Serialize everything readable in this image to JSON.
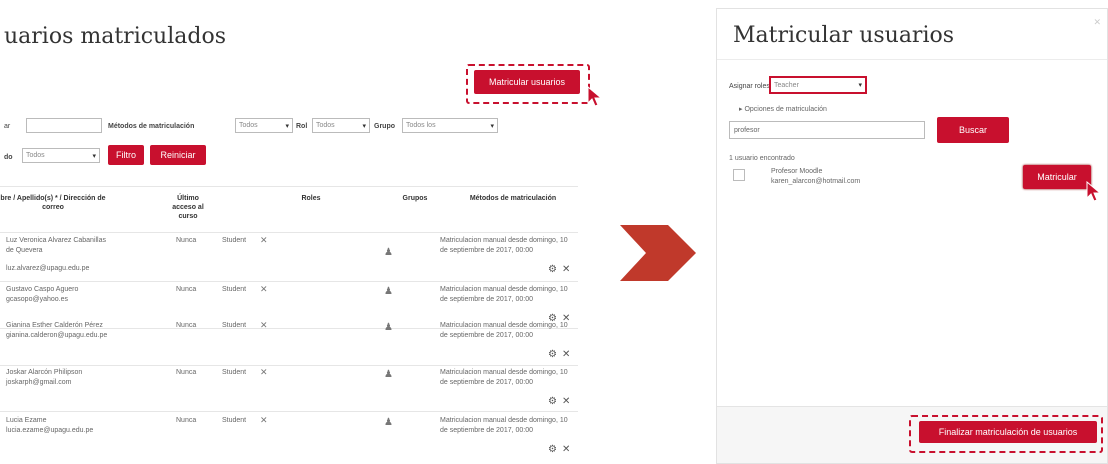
{
  "left_panel": {
    "title": "uarios matriculados",
    "enrol_button": "Matricular usuarios",
    "filters": {
      "search_label": "ar",
      "search_value": "",
      "methods_label": "Métodos de matriculación",
      "methods_value": "Todos",
      "role_label": "Rol",
      "role_value": "Todos",
      "group_label": "Grupo",
      "group_value": "Todos los",
      "status_label": "do",
      "status_value": "Todos",
      "filter_button": "Filtro",
      "reset_button": "Reiniciar"
    },
    "columns": [
      "bre / Apellido(s) * / Dirección de correo",
      "Último acceso al curso",
      "Roles",
      "Grupos",
      "Métodos de matriculación"
    ],
    "rows": [
      {
        "name": "Luz Veronica Alvarez Cabanillas de Quevera",
        "email": "luz.alvarez@upagu.edu.pe",
        "last_access": "Nunca",
        "role": "Student",
        "method": "Matriculacion manual desde domingo, 10 de septiembre de 2017, 00:00"
      },
      {
        "name": "Gustavo Caspo Aguero",
        "email": "gcasopo@yahoo.es",
        "last_access": "Nunca",
        "role": "Student",
        "method": "Matriculacion manual desde domingo, 10 de septiembre de 2017, 00:00"
      },
      {
        "name": "Gianina Esther Calderón Pérez",
        "email": "gianina.calderon@upagu.edu.pe",
        "last_access": "Nunca",
        "role": "Student",
        "method": "Matriculacion manual desde domingo, 10 de septiembre de 2017, 00:00"
      },
      {
        "name": "Joskar Alarcón Philipson",
        "email": "joskarph@gmail.com",
        "last_access": "Nunca",
        "role": "Student",
        "method": "Matriculacion manual desde domingo, 10 de septiembre de 2017, 00:00"
      },
      {
        "name": "Lucia Ezame",
        "email": "lucia.ezame@upagu.edu.pe",
        "last_access": "Nunca",
        "role": "Student",
        "method": "Matriculacion manual desde domingo, 10 de septiembre de 2017, 00:00"
      }
    ]
  },
  "right_panel": {
    "title": "Matricular usuarios",
    "assign_role_label": "Asignar roles",
    "assign_role_value": "Teacher",
    "options_link": "Opciones de matriculación",
    "search_value": "profesor",
    "search_button": "Buscar",
    "found_text": "1 usuario encontrado",
    "user_name": "Profesor Moodle",
    "user_email": "karen_alarcon@hotmail.com",
    "enrol_button": "Matricular",
    "finish_button": "Finalizar matriculación de usuarios"
  },
  "colors": {
    "accent": "#c8102e",
    "arrow": "#c0392b"
  }
}
